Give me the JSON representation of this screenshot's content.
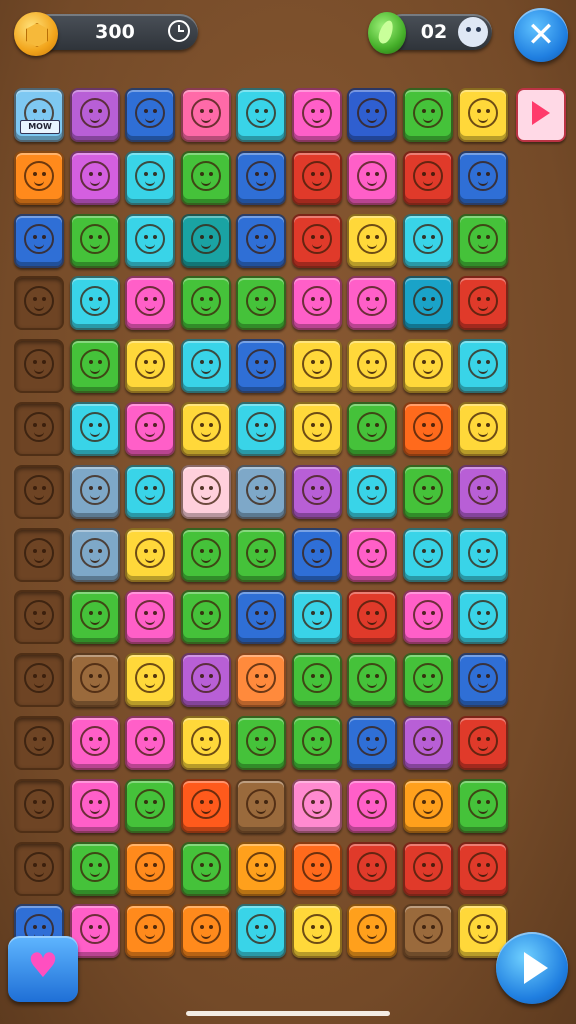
{
  "hud": {
    "score": "300",
    "gems": "02"
  },
  "colors": {
    "board": "#744a28",
    "primary_button": "#1f7ee0",
    "heart": "#ff4fc0"
  },
  "icons": {
    "score_coin": "coin-icon",
    "timer": "clock-icon",
    "gem": "gem-icon",
    "settings_face": "face-icon",
    "close": "close-icon",
    "hint": "heart-icon",
    "play": "play-icon",
    "side_arrow": "arrow-right-icon"
  },
  "close_symbol": "✕",
  "heart_symbol": "♥",
  "grid": {
    "rows": [
      {
        "tiles": [
          "#7ec8f2",
          "#b85fd6",
          "#2f6fd6",
          "#ff6aa8",
          "#39d4e8",
          "#ff5fc8",
          "#2f5fd0",
          "#45c23a",
          "#ffd83a"
        ],
        "first_label": "MOW"
      },
      {
        "tiles": [
          "#ff8a1c",
          "#d45fe0",
          "#39d4e8",
          "#45c23a",
          "#2f6fd6",
          "#e03a2a",
          "#ff5fc8",
          "#e03a2a",
          "#2f6fd6"
        ]
      },
      {
        "tiles": [
          "#2f6fd6",
          "#45c23a",
          "#39d4e8",
          "#1aa3a3",
          "#2f6fd6",
          "#e03a2a",
          "#ffd83a",
          "#39d4e8",
          "#45c23a"
        ]
      },
      {
        "tiles": [
          "empty",
          "#39d4e8",
          "#ff5fc8",
          "#45c23a",
          "#45c23a",
          "#ff5fc8",
          "#ff5fc8",
          "#1aa3c8",
          "#e03a2a"
        ]
      },
      {
        "tiles": [
          "empty",
          "#45c23a",
          "#ffd83a",
          "#39d4e8",
          "#2f6fd6",
          "#ffd83a",
          "#ffd83a",
          "#ffd83a",
          "#39d4e8"
        ]
      },
      {
        "tiles": [
          "empty",
          "#39d4e8",
          "#ff5fc8",
          "#ffd83a",
          "#39d4e8",
          "#ffd83a",
          "#45c23a",
          "#ff6a1c",
          "#ffd83a"
        ]
      },
      {
        "tiles": [
          "empty",
          "#7ea8c8",
          "#39d4e8",
          "#ffd0dc",
          "#7ea8c8",
          "#b85fd6",
          "#39d4e8",
          "#45c23a",
          "#b85fd6"
        ]
      },
      {
        "tiles": [
          "empty",
          "#7ea8c8",
          "#ffd83a",
          "#45c23a",
          "#45c23a",
          "#2f6fd6",
          "#ff5fc8",
          "#39d4e8",
          "#39d4e8"
        ]
      },
      {
        "tiles": [
          "empty",
          "#45c23a",
          "#ff5fc8",
          "#45c23a",
          "#2f6fd6",
          "#39d4e8",
          "#e03a2a",
          "#ff5fc8",
          "#39d4e8"
        ]
      },
      {
        "tiles": [
          "empty",
          "#9a6a3c",
          "#ffd83a",
          "#b85fd6",
          "#ff8a3c",
          "#45c23a",
          "#45c23a",
          "#45c23a",
          "#2f6fd6"
        ]
      },
      {
        "tiles": [
          "empty",
          "#ff5fc8",
          "#ff5fc8",
          "#ffd83a",
          "#45c23a",
          "#45c23a",
          "#2f6fd6",
          "#b85fd6",
          "#e03a2a"
        ]
      },
      {
        "tiles": [
          "empty",
          "#ff5fc8",
          "#45c23a",
          "#ff5a1c",
          "#9a6a3c",
          "#ff8ad0",
          "#ff5fc8",
          "#ffa01c",
          "#45c23a"
        ]
      },
      {
        "tiles": [
          "empty",
          "#45c23a",
          "#ff8a1c",
          "#45c23a",
          "#ffa01c",
          "#ff6a1c",
          "#e03a2a",
          "#e03a2a",
          "#e03a2a"
        ]
      },
      {
        "tiles": [
          "#2f6fd6",
          "#ff5fc8",
          "#ff8a1c",
          "#ff8a1c",
          "#39d4e8",
          "#ffd83a",
          "#ffa01c",
          "#9a6a3c",
          "#ffd83a"
        ]
      }
    ]
  }
}
